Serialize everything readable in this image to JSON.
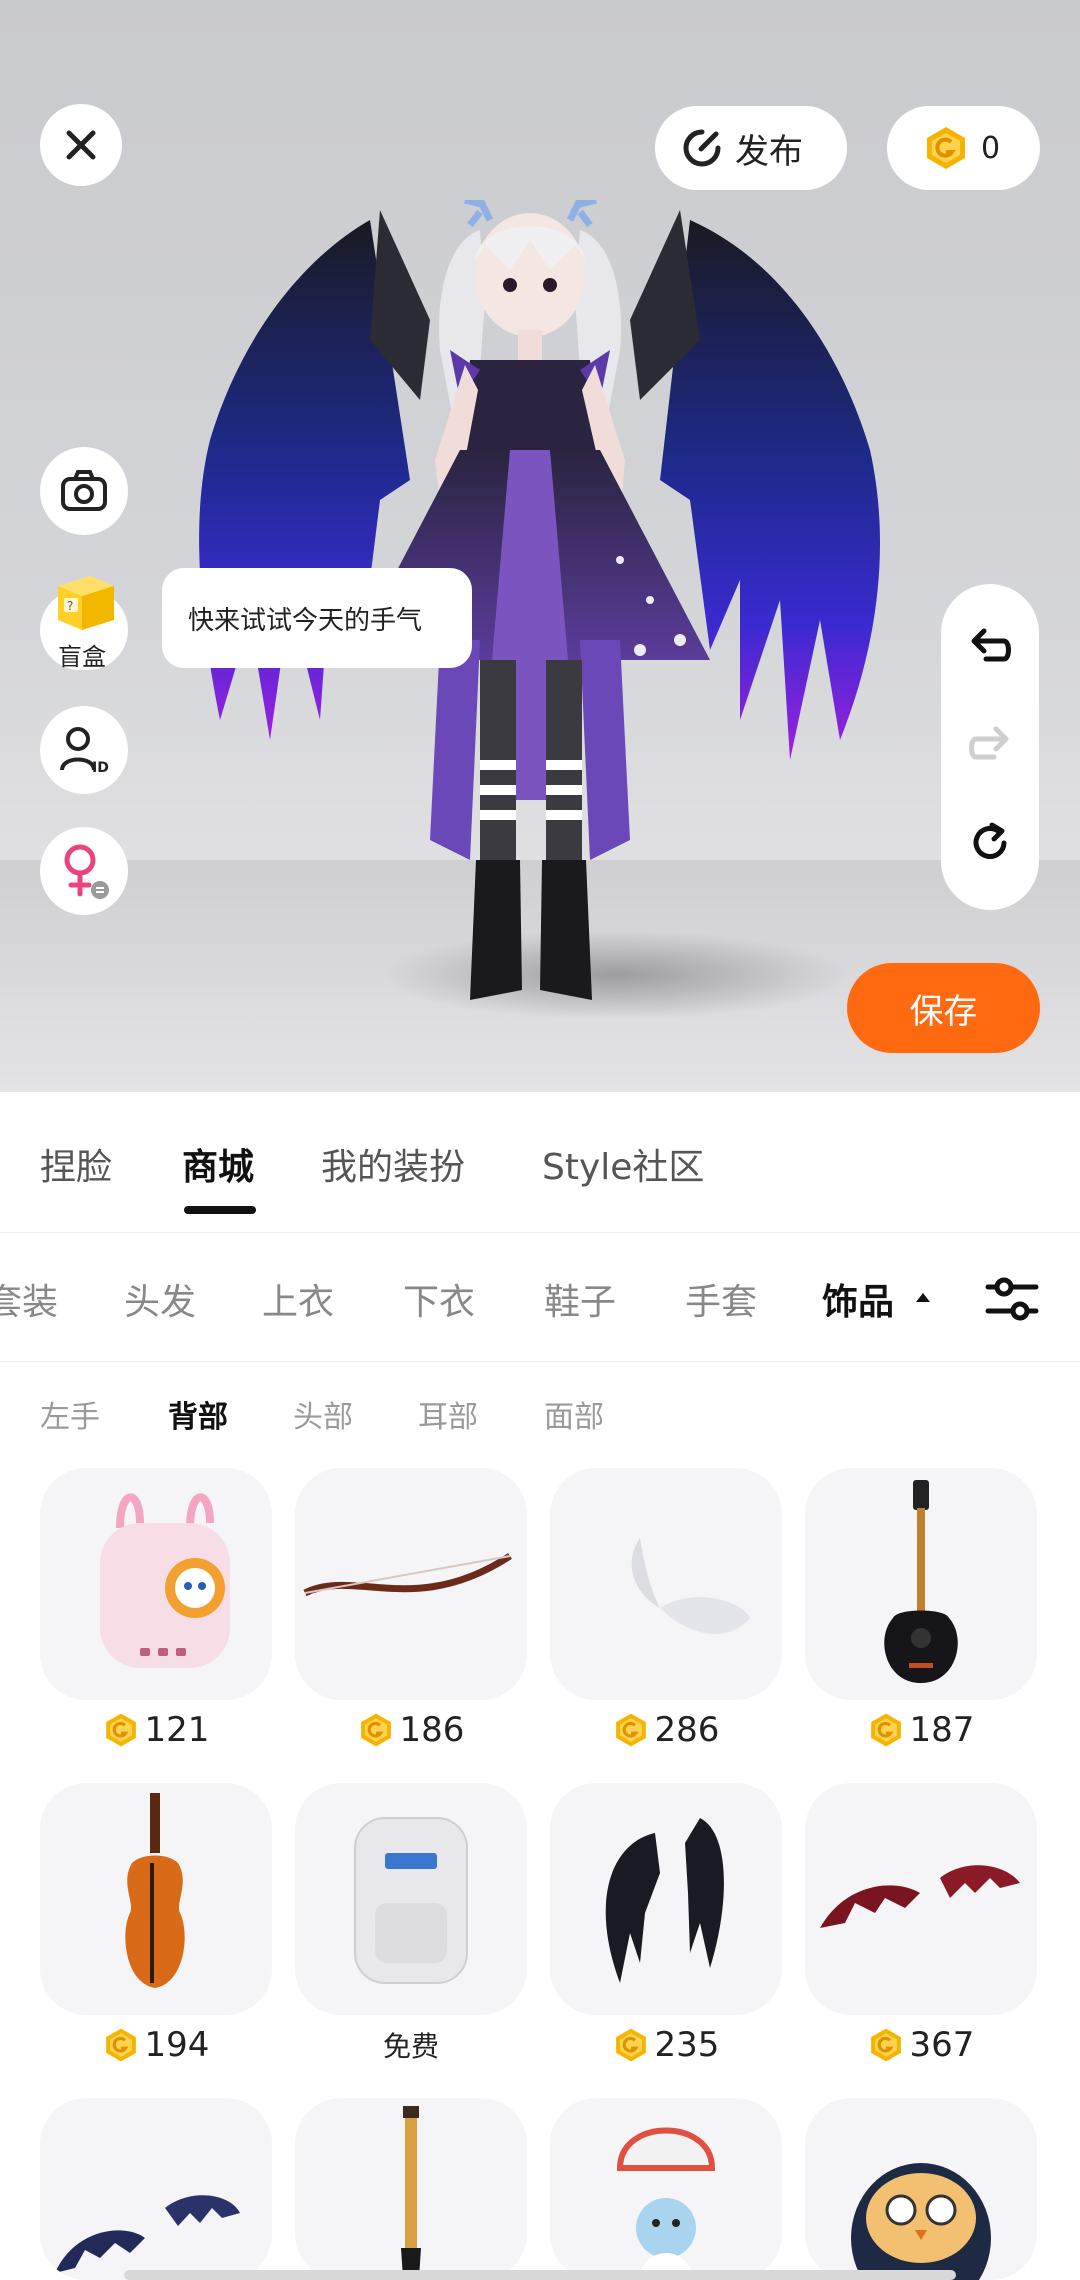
{
  "header": {
    "publish_label": "发布",
    "coin_balance": "0"
  },
  "side": {
    "blind_box_label": "盲盒",
    "tooltip": "快来试试今天的手气"
  },
  "save_label": "保存",
  "main_tabs": [
    {
      "label": "捏脸",
      "active": false
    },
    {
      "label": "商城",
      "active": true
    },
    {
      "label": "我的装扮",
      "active": false
    },
    {
      "label": "Style社区",
      "active": false
    }
  ],
  "categories": [
    {
      "label": "套装",
      "active": false
    },
    {
      "label": "头发",
      "active": false
    },
    {
      "label": "上衣",
      "active": false
    },
    {
      "label": "下衣",
      "active": false
    },
    {
      "label": "鞋子",
      "active": false
    },
    {
      "label": "手套",
      "active": false
    },
    {
      "label": "饰品",
      "active": true
    }
  ],
  "subcategories": [
    {
      "label": "左手",
      "active": false
    },
    {
      "label": "背部",
      "active": true
    },
    {
      "label": "头部",
      "active": false
    },
    {
      "label": "耳部",
      "active": false
    },
    {
      "label": "面部",
      "active": false
    }
  ],
  "items": [
    {
      "name": "pink-backpack",
      "price": "121"
    },
    {
      "name": "bow",
      "price": "186"
    },
    {
      "name": "white-wings",
      "price": "286"
    },
    {
      "name": "guitar",
      "price": "187"
    },
    {
      "name": "violin",
      "price": "194"
    },
    {
      "name": "white-backpack",
      "price": "免费"
    },
    {
      "name": "black-wings",
      "price": "235"
    },
    {
      "name": "red-bat-wings",
      "price": "367"
    },
    {
      "name": "blue-bat-wings",
      "price": ""
    },
    {
      "name": "brush",
      "price": ""
    },
    {
      "name": "penguin-parachute",
      "price": ""
    },
    {
      "name": "owl-penguin",
      "price": ""
    }
  ],
  "colors": {
    "accent": "#ff6a10",
    "coin": "#f5b400"
  }
}
